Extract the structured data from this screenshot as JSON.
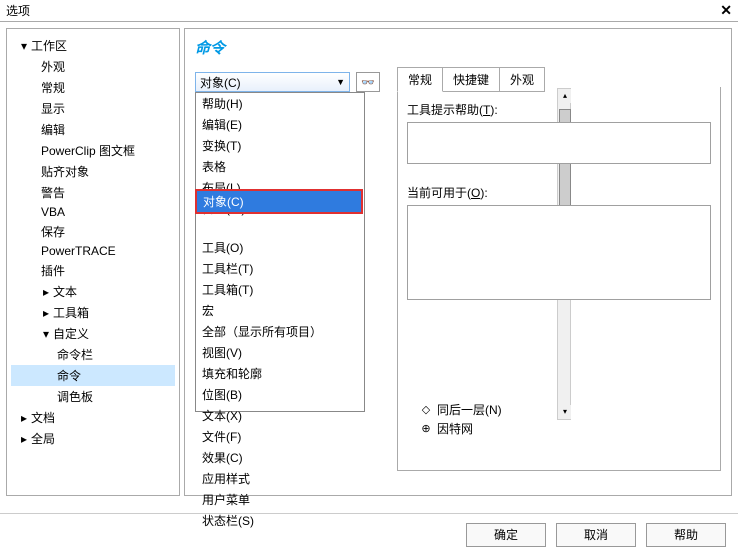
{
  "window": {
    "title": "选项",
    "close": "✕"
  },
  "tree": {
    "workspace": "工作区",
    "items_a": [
      "外观",
      "常规",
      "显示",
      "编辑",
      "PowerClip 图文框",
      "贴齐对象",
      "警告",
      "VBA",
      "保存",
      "PowerTRACE",
      "插件"
    ],
    "text": "文本",
    "toolbox": "工具箱",
    "customize": "自定义",
    "customize_children": [
      "命令栏",
      "命令",
      "调色板"
    ],
    "doc": "文档",
    "global": "全局"
  },
  "main": {
    "heading": "命令",
    "dropdown_value": "对象(C)",
    "dropdown_items": [
      "帮助(H)",
      "编辑(E)",
      "变换(T)",
      "表格",
      "布局(L)",
      "窗口(W)",
      "对象(C)",
      "工具(O)",
      "工具栏(T)",
      "工具箱(T)",
      "宏",
      "全部（显示所有项目）",
      "视图(V)",
      "填充和轮廓",
      "位图(B)",
      "文本(X)",
      "文件(F)",
      "效果(C)",
      "应用样式",
      "用户菜单",
      "状态栏(S)"
    ],
    "highlight": "对象(C)",
    "leftover": [
      {
        "icon": "◇",
        "text": "同后一层(N)"
      },
      {
        "icon": "⊕",
        "text": "因特网"
      }
    ],
    "tabs": [
      "常规",
      "快捷键",
      "外观"
    ],
    "label_tooltip_pre": "工具提示帮助(",
    "label_tooltip_u": "T",
    "label_tooltip_post": "):",
    "label_avail_pre": "当前可用于(",
    "label_avail_u": "O",
    "label_avail_post": "):"
  },
  "footer": {
    "ok": "确定",
    "cancel": "取消",
    "help": "帮助"
  },
  "sb": {
    "up": "▴",
    "down": "▾"
  }
}
